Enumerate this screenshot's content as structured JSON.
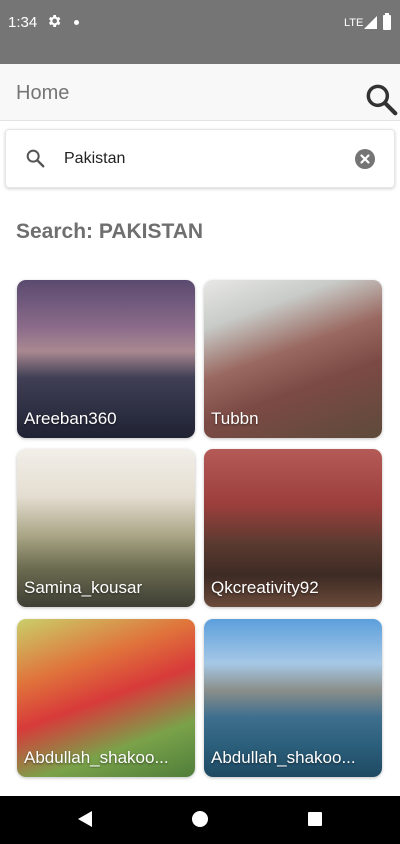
{
  "status_bar": {
    "time": "1:34",
    "network": "LTE",
    "icons": [
      "gear-icon",
      "dot-icon",
      "signal-icon",
      "battery-icon"
    ]
  },
  "app_bar": {
    "title": "Home",
    "search_icon": "search-icon"
  },
  "search": {
    "value": "Pakistan",
    "placeholder": "",
    "clear_icon": "clear-icon"
  },
  "results": {
    "heading": "Search: PAKISTAN",
    "items": [
      {
        "label": "Areeban360"
      },
      {
        "label": "Tubbn"
      },
      {
        "label": "Samina_kousar"
      },
      {
        "label": "Qkcreativity92"
      },
      {
        "label": "Abdullah_shakoo..."
      },
      {
        "label": "Abdullah_shakoo..."
      }
    ]
  },
  "nav_bar": {
    "icons": [
      "back-icon",
      "home-icon",
      "recents-icon"
    ]
  },
  "colors": {
    "status_bar": "#757575",
    "app_bar": "#f8f8f8",
    "heading": "#6f6f6f",
    "nav_bar": "#000000"
  }
}
